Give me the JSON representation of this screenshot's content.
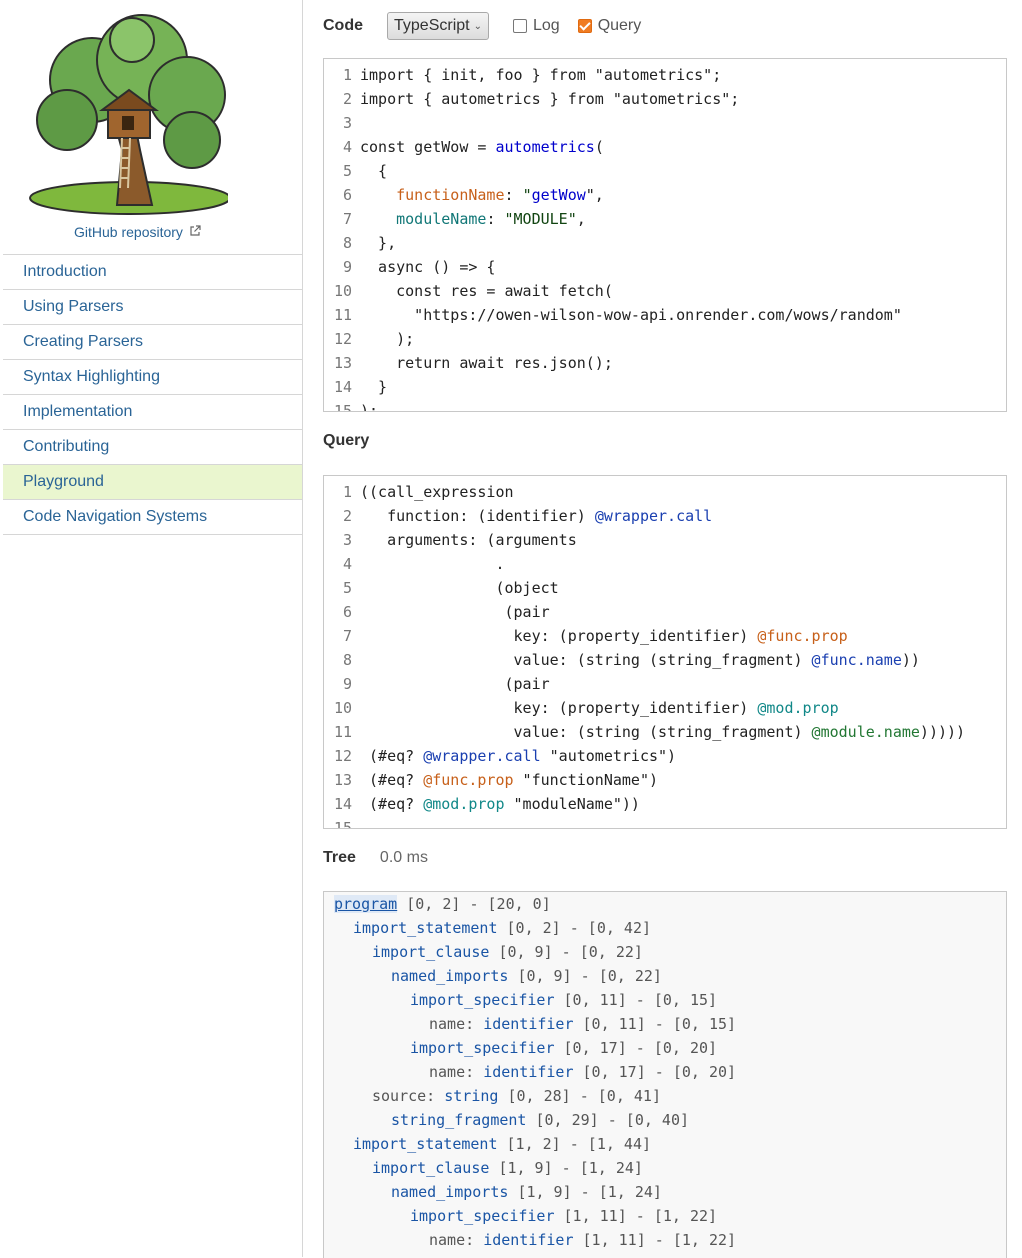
{
  "sidebar": {
    "repo_link": "GitHub repository",
    "nav": [
      {
        "label": "Introduction",
        "active": false
      },
      {
        "label": "Using Parsers",
        "active": false
      },
      {
        "label": "Creating Parsers",
        "active": false
      },
      {
        "label": "Syntax Highlighting",
        "active": false
      },
      {
        "label": "Implementation",
        "active": false
      },
      {
        "label": "Contributing",
        "active": false
      },
      {
        "label": "Playground",
        "active": true
      },
      {
        "label": "Code Navigation Systems",
        "active": false
      }
    ]
  },
  "main": {
    "code_label": "Code",
    "language": "TypeScript",
    "log_label": "Log",
    "log_checked": false,
    "query_checkbox_label": "Query",
    "query_checked": true,
    "query_label": "Query",
    "tree_label": "Tree",
    "tree_time": "0.0 ms",
    "code_lines": [
      [
        {
          "t": "import { init, foo } from \"autometrics\";"
        }
      ],
      [
        {
          "t": "import { autometrics } from \"autometrics\";"
        }
      ],
      [
        {
          "t": ""
        }
      ],
      [
        {
          "t": "const getWow = "
        },
        {
          "t": "autometrics",
          "c": "c-fn"
        },
        {
          "t": "("
        }
      ],
      [
        {
          "t": "  {"
        }
      ],
      [
        {
          "t": "    "
        },
        {
          "t": "functionName",
          "c": "c-prop"
        },
        {
          "t": ": "
        },
        {
          "t": "\"",
          "c": "c-str"
        },
        {
          "t": "getWow",
          "c": "c-fn"
        },
        {
          "t": "\","
        }
      ],
      [
        {
          "t": "    "
        },
        {
          "t": "moduleName",
          "c": "c-mod"
        },
        {
          "t": ": "
        },
        {
          "t": "\"MODULE\"",
          "c": "c-str"
        },
        {
          "t": ","
        }
      ],
      [
        {
          "t": "  },"
        }
      ],
      [
        {
          "t": "  async () => {"
        }
      ],
      [
        {
          "t": "    const res = await fetch("
        }
      ],
      [
        {
          "t": "      \"https://owen-wilson-wow-api.onrender.com/wows/random\""
        }
      ],
      [
        {
          "t": "    );"
        }
      ],
      [
        {
          "t": "    return await res.json();"
        }
      ],
      [
        {
          "t": "  }"
        }
      ],
      [
        {
          "t": ");"
        }
      ]
    ],
    "query_lines": [
      [
        {
          "t": "((call_expression"
        }
      ],
      [
        {
          "t": "   function: (identifier) "
        },
        {
          "t": "@wrapper.call",
          "c": "c-cap-blue"
        }
      ],
      [
        {
          "t": "   arguments: (arguments"
        }
      ],
      [
        {
          "t": "               ."
        }
      ],
      [
        {
          "t": "               (object"
        }
      ],
      [
        {
          "t": "                (pair"
        }
      ],
      [
        {
          "t": "                 key: (property_identifier) "
        },
        {
          "t": "@func.prop",
          "c": "c-cap-orange"
        }
      ],
      [
        {
          "t": "                 value: (string (string_fragment) "
        },
        {
          "t": "@func.name",
          "c": "c-cap-blue"
        },
        {
          "t": "))"
        }
      ],
      [
        {
          "t": "                (pair"
        }
      ],
      [
        {
          "t": "                 key: (property_identifier) "
        },
        {
          "t": "@mod.prop",
          "c": "c-cap-teal"
        }
      ],
      [
        {
          "t": "                 value: (string (string_fragment) "
        },
        {
          "t": "@module.name",
          "c": "c-cap-green"
        },
        {
          "t": ")))))"
        }
      ],
      [
        {
          "t": " (#eq? "
        },
        {
          "t": "@wrapper.call",
          "c": "c-cap-blue"
        },
        {
          "t": " \"autometrics\")"
        }
      ],
      [
        {
          "t": " (#eq? "
        },
        {
          "t": "@func.prop",
          "c": "c-cap-orange"
        },
        {
          "t": " \"functionName\")"
        }
      ],
      [
        {
          "t": " (#eq? "
        },
        {
          "t": "@mod.prop",
          "c": "c-cap-teal"
        },
        {
          "t": " \"moduleName\"))"
        }
      ],
      [
        {
          "t": ""
        }
      ]
    ],
    "tree_rows": [
      {
        "indent": 0,
        "field": "",
        "node": "program",
        "range": "[0, 2] - [20, 0]",
        "selected": true
      },
      {
        "indent": 1,
        "field": "",
        "node": "import_statement",
        "range": "[0, 2] - [0, 42]"
      },
      {
        "indent": 2,
        "field": "",
        "node": "import_clause",
        "range": "[0, 9] - [0, 22]"
      },
      {
        "indent": 3,
        "field": "",
        "node": "named_imports",
        "range": "[0, 9] - [0, 22]"
      },
      {
        "indent": 4,
        "field": "",
        "node": "import_specifier",
        "range": "[0, 11] - [0, 15]"
      },
      {
        "indent": 5,
        "field": "name: ",
        "node": "identifier",
        "range": "[0, 11] - [0, 15]"
      },
      {
        "indent": 4,
        "field": "",
        "node": "import_specifier",
        "range": "[0, 17] - [0, 20]"
      },
      {
        "indent": 5,
        "field": "name: ",
        "node": "identifier",
        "range": "[0, 17] - [0, 20]"
      },
      {
        "indent": 2,
        "field": "source: ",
        "node": "string",
        "range": "[0, 28] - [0, 41]"
      },
      {
        "indent": 3,
        "field": "",
        "node": "string_fragment",
        "range": "[0, 29] - [0, 40]"
      },
      {
        "indent": 1,
        "field": "",
        "node": "import_statement",
        "range": "[1, 2] - [1, 44]"
      },
      {
        "indent": 2,
        "field": "",
        "node": "import_clause",
        "range": "[1, 9] - [1, 24]"
      },
      {
        "indent": 3,
        "field": "",
        "node": "named_imports",
        "range": "[1, 9] - [1, 24]"
      },
      {
        "indent": 4,
        "field": "",
        "node": "import_specifier",
        "range": "[1, 11] - [1, 22]"
      },
      {
        "indent": 5,
        "field": "name: ",
        "node": "identifier",
        "range": "[1, 11] - [1, 22]"
      }
    ]
  }
}
